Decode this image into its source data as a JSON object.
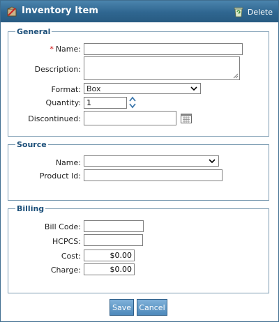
{
  "window": {
    "title": "Inventory Item",
    "delete_label": "Delete"
  },
  "general": {
    "legend": "General",
    "required_marker": "*",
    "name_label": "Name:",
    "name_value": "",
    "description_label": "Description:",
    "description_value": "",
    "format_label": "Format:",
    "format_value": "Box",
    "quantity_label": "Quantity:",
    "quantity_value": "1",
    "discontinued_label": "Discontinued:",
    "discontinued_value": ""
  },
  "source": {
    "legend": "Source",
    "name_label": "Name:",
    "name_value": "",
    "product_id_label": "Product Id:",
    "product_id_value": ""
  },
  "billing": {
    "legend": "Billing",
    "bill_code_label": "Bill Code:",
    "bill_code_value": "",
    "hcpcs_label": "HCPCS:",
    "hcpcs_value": "",
    "cost_label": "Cost:",
    "cost_value": "$0.00",
    "charge_label": "Charge:",
    "charge_value": "$0.00"
  },
  "actions": {
    "save_label": "Save",
    "cancel_label": "Cancel"
  },
  "colors": {
    "titlebar": "#2f6690",
    "legend_text": "#1c4f79",
    "required": "#cc0000",
    "button": "#4d89bb"
  }
}
